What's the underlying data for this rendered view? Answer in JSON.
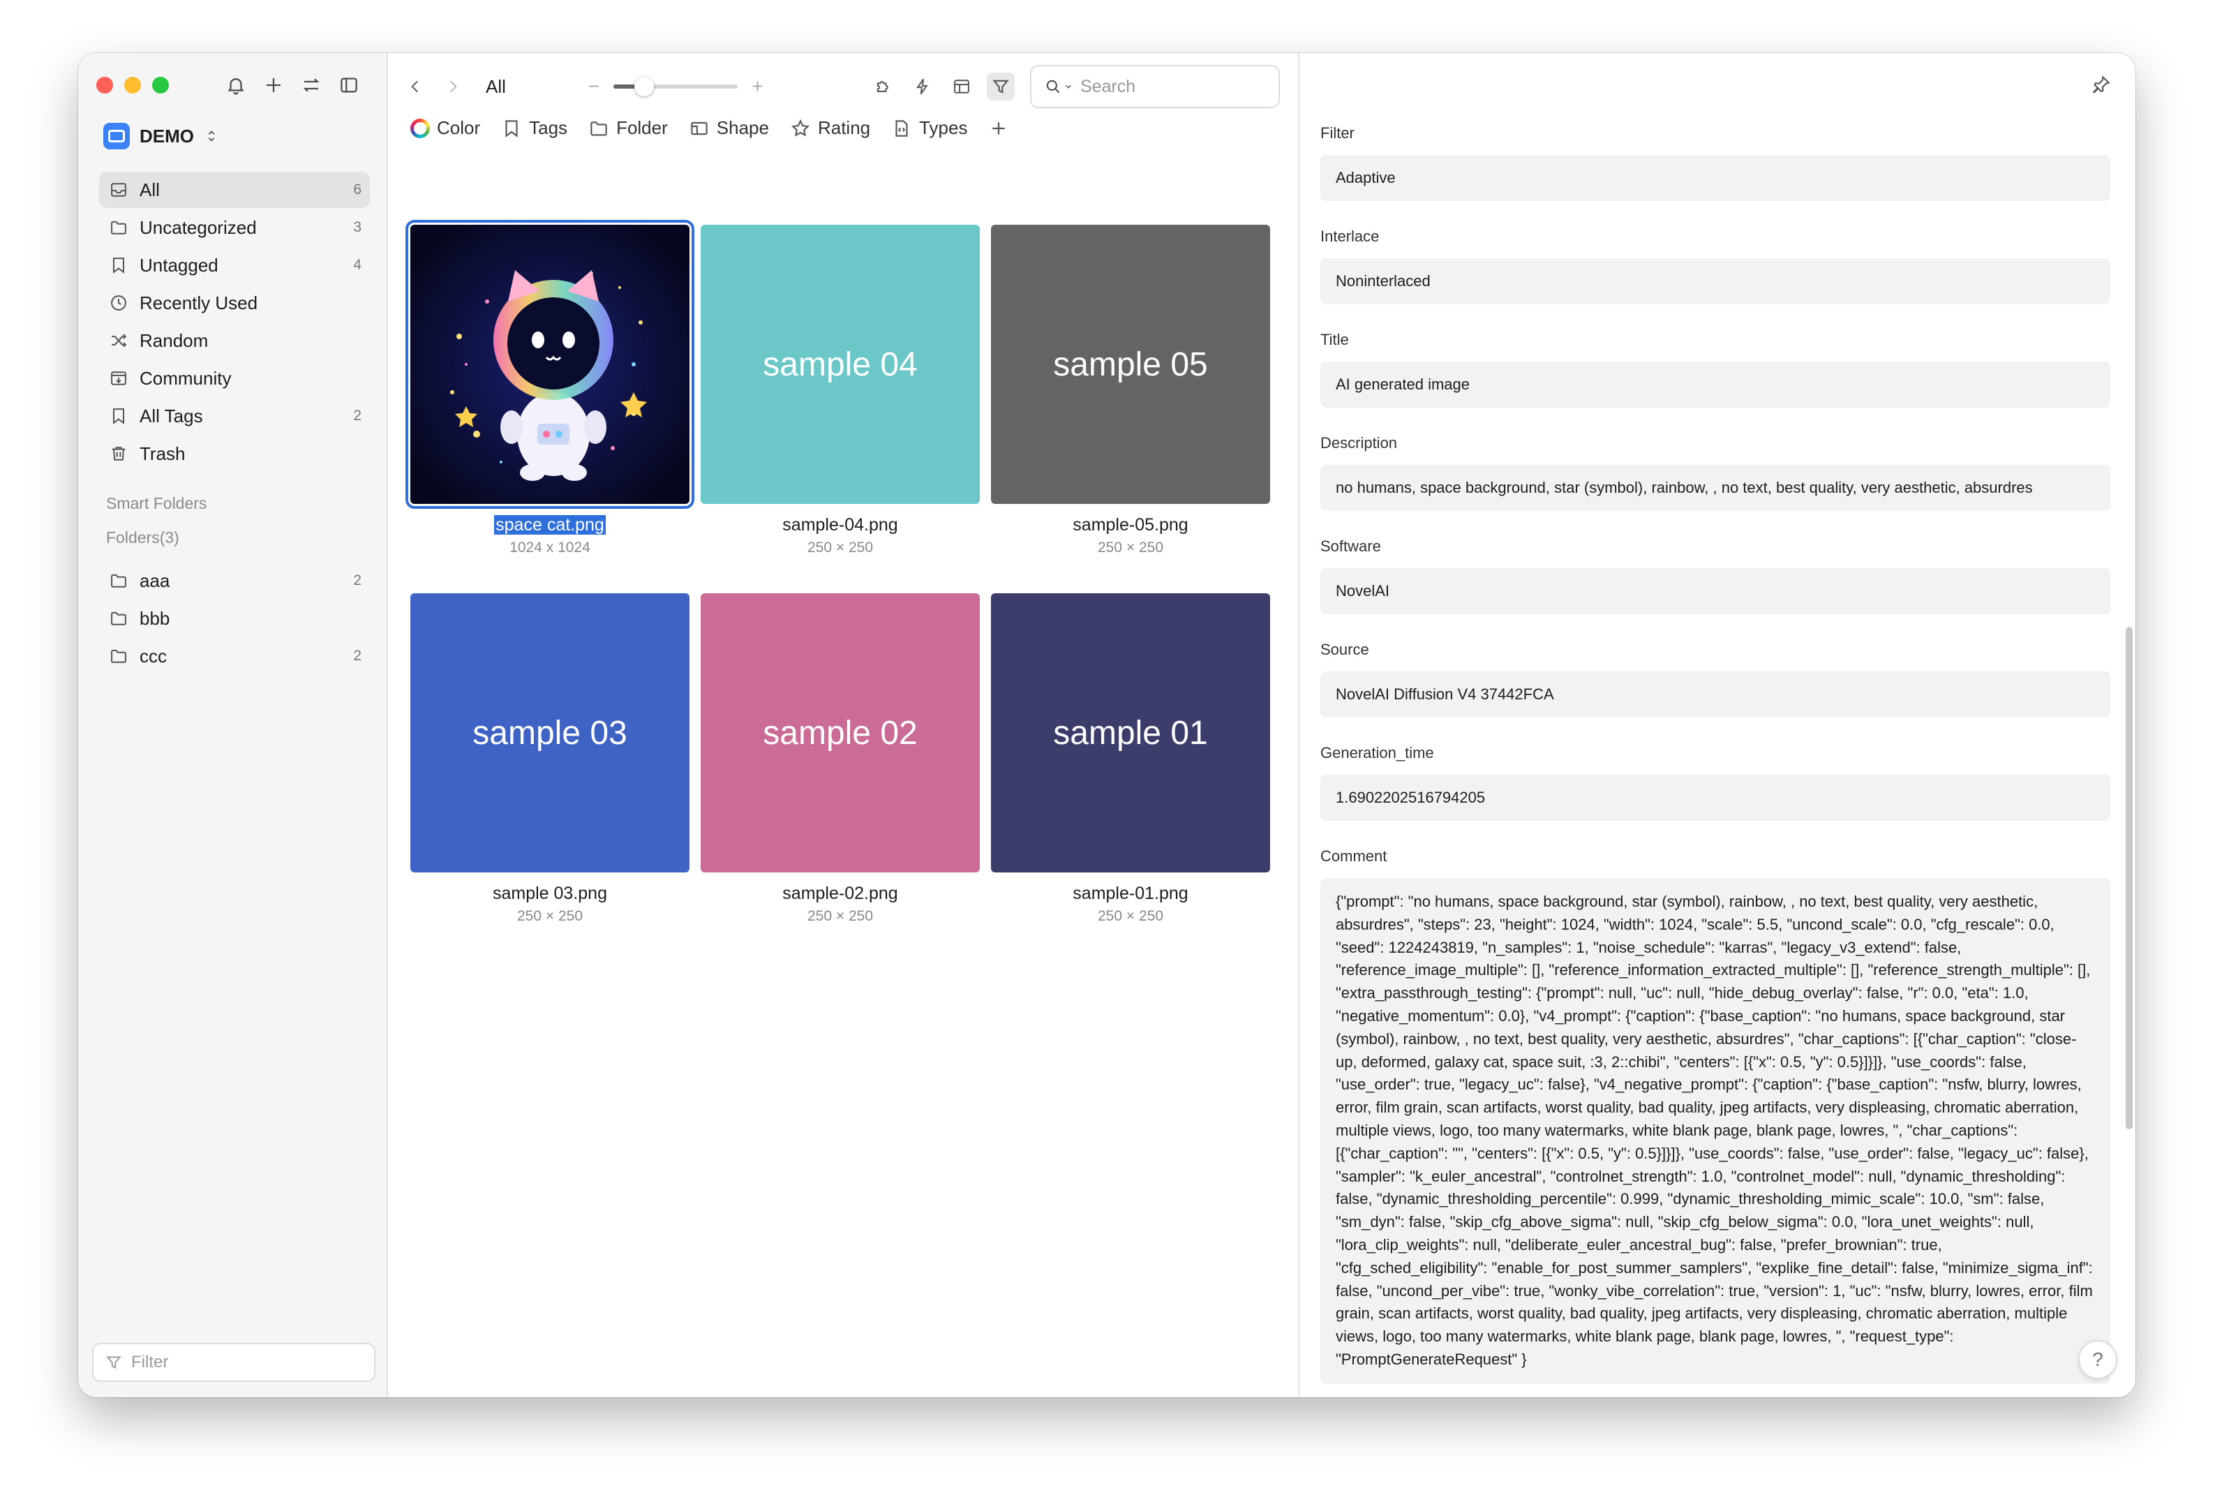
{
  "sidebar": {
    "library_name": "DEMO",
    "items": [
      {
        "label": "All",
        "count": "6",
        "icon": "inbox-icon"
      },
      {
        "label": "Uncategorized",
        "count": "3",
        "icon": "folder-icon"
      },
      {
        "label": "Untagged",
        "count": "4",
        "icon": "bookmark-icon"
      },
      {
        "label": "Recently Used",
        "count": "",
        "icon": "clock-icon"
      },
      {
        "label": "Random",
        "count": "",
        "icon": "shuffle-icon"
      },
      {
        "label": "Community",
        "count": "",
        "icon": "download-box-icon"
      },
      {
        "label": "All Tags",
        "count": "2",
        "icon": "bookmark-icon"
      },
      {
        "label": "Trash",
        "count": "",
        "icon": "trash-icon"
      }
    ],
    "smart_folders_title": "Smart Folders",
    "folders_title": "Folders(3)",
    "folders": [
      {
        "label": "aaa",
        "count": "2"
      },
      {
        "label": "bbb",
        "count": ""
      },
      {
        "label": "ccc",
        "count": "2"
      }
    ],
    "filter_placeholder": "Filter"
  },
  "toolbar": {
    "breadcrumb": "All",
    "zoom_minus": "−",
    "zoom_plus": "+",
    "zoom_level": 0.2,
    "search_placeholder": "Search"
  },
  "filters": [
    {
      "label": "Color",
      "icon": "color-ring-icon"
    },
    {
      "label": "Tags",
      "icon": "bookmark-icon"
    },
    {
      "label": "Folder",
      "icon": "folder-icon"
    },
    {
      "label": "Shape",
      "icon": "shape-icon"
    },
    {
      "label": "Rating",
      "icon": "star-icon"
    },
    {
      "label": "Types",
      "icon": "file-type-icon"
    }
  ],
  "items": [
    {
      "thumb_text": "",
      "name": "space cat.png",
      "dims": "1024 x 1024",
      "color": "#0b0d3a",
      "selected": true
    },
    {
      "thumb_text": "sample 04",
      "name": "sample-04.png",
      "dims": "250 × 250",
      "color": "#6cc8c8"
    },
    {
      "thumb_text": "sample 05",
      "name": "sample-05.png",
      "dims": "250 × 250",
      "color": "#646464"
    },
    {
      "thumb_text": "sample 03",
      "name": "sample 03.png",
      "dims": "250 × 250",
      "color": "#3f63c4"
    },
    {
      "thumb_text": "sample 02",
      "name": "sample-02.png",
      "dims": "250 × 250",
      "color": "#cb6c97"
    },
    {
      "thumb_text": "sample 01",
      "name": "sample-01.png",
      "dims": "250 × 250",
      "color": "#3d3d6b"
    }
  ],
  "inspector": {
    "fields": [
      {
        "label": "Filter",
        "value": "Adaptive"
      },
      {
        "label": "Interlace",
        "value": "Noninterlaced"
      },
      {
        "label": "Title",
        "value": "AI generated image"
      },
      {
        "label": "Description",
        "value": "no humans, space background, star (symbol), rainbow, , no text, best quality, very aesthetic, absurdres"
      },
      {
        "label": "Software",
        "value": "NovelAI"
      },
      {
        "label": "Source",
        "value": "NovelAI Diffusion V4 37442FCA"
      },
      {
        "label": "Generation_time",
        "value": "1.6902202516794205"
      }
    ],
    "comment_label": "Comment",
    "comment_value": "{\"prompt\": \"no humans, space background, star (symbol), rainbow, , no text, best quality, very aesthetic, absurdres\", \"steps\": 23, \"height\": 1024, \"width\": 1024, \"scale\": 5.5, \"uncond_scale\": 0.0, \"cfg_rescale\": 0.0, \"seed\": 1224243819, \"n_samples\": 1, \"noise_schedule\": \"karras\", \"legacy_v3_extend\": false, \"reference_image_multiple\": [], \"reference_information_extracted_multiple\": [], \"reference_strength_multiple\": [], \"extra_passthrough_testing\": {\"prompt\": null, \"uc\": null, \"hide_debug_overlay\": false, \"r\": 0.0, \"eta\": 1.0, \"negative_momentum\": 0.0}, \"v4_prompt\": {\"caption\": {\"base_caption\": \"no humans, space background, star (symbol), rainbow, , no text, best quality, very aesthetic, absurdres\", \"char_captions\": [{\"char_caption\": \"close-up, deformed, galaxy cat, space suit, :3, 2::chibi\", \"centers\": [{\"x\": 0.5, \"y\": 0.5}]}]}, \"use_coords\": false, \"use_order\": true, \"legacy_uc\": false}, \"v4_negative_prompt\": {\"caption\": {\"base_caption\": \"nsfw, blurry, lowres, error, film grain, scan artifacts, worst quality, bad quality, jpeg artifacts, very displeasing, chromatic aberration, multiple views, logo, too many watermarks, white blank page, blank page, lowres, \", \"char_captions\": [{\"char_caption\": \"\", \"centers\": [{\"x\": 0.5, \"y\": 0.5}]}]}, \"use_coords\": false, \"use_order\": false, \"legacy_uc\": false}, \"sampler\": \"k_euler_ancestral\", \"controlnet_strength\": 1.0, \"controlnet_model\": null, \"dynamic_thresholding\": false, \"dynamic_thresholding_percentile\": 0.999, \"dynamic_thresholding_mimic_scale\": 10.0, \"sm\": false, \"sm_dyn\": false, \"skip_cfg_above_sigma\": null, \"skip_cfg_below_sigma\": 0.0, \"lora_unet_weights\": null, \"lora_clip_weights\": null, \"deliberate_euler_ancestral_bug\": false, \"prefer_brownian\": true, \"cfg_sched_eligibility\": \"enable_for_post_summer_samplers\", \"explike_fine_detail\": false, \"minimize_sigma_inf\": false, \"uncond_per_vibe\": true, \"wonky_vibe_correlation\": true, \"version\": 1, \"uc\": \"nsfw, blurry, lowres, error, film grain, scan artifacts, worst quality, bad quality, jpeg artifacts, very displeasing, chromatic aberration, multiple views, logo, too many watermarks, white blank page, blank page, lowres, \", \"request_type\": \"PromptGenerateRequest\" }",
    "help_label": "?"
  }
}
